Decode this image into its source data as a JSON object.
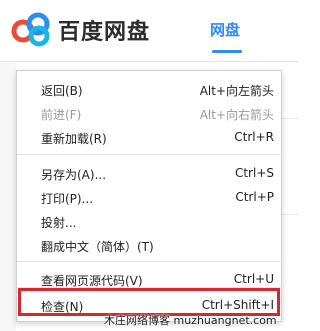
{
  "app": {
    "brand": "百度网盘",
    "active_tab": "网盘",
    "accent_color": "#2e8bf0"
  },
  "context_menu": {
    "items": [
      {
        "label": "返回(B)",
        "shortcut": "Alt+向左箭头",
        "enabled": true
      },
      {
        "label": "前进(F)",
        "shortcut": "Alt+向右箭头",
        "enabled": false
      },
      {
        "label": "重新加载(R)",
        "shortcut": "Ctrl+R",
        "enabled": true
      },
      {
        "label": "另存为(A)...",
        "shortcut": "Ctrl+S",
        "enabled": true
      },
      {
        "label": "打印(P)...",
        "shortcut": "Ctrl+P",
        "enabled": true
      },
      {
        "label": "投射...",
        "shortcut": "",
        "enabled": true
      },
      {
        "label": "翻成中文（简体）(T)",
        "shortcut": "",
        "enabled": true
      },
      {
        "label": "查看网页源代码(V)",
        "shortcut": "Ctrl+U",
        "enabled": true
      },
      {
        "label": "检查(N)",
        "shortcut": "Ctrl+Shift+I",
        "enabled": true
      }
    ],
    "highlight_color": "#d9262c"
  },
  "watermark": "木庄网络博客 muzhuangnet.com"
}
